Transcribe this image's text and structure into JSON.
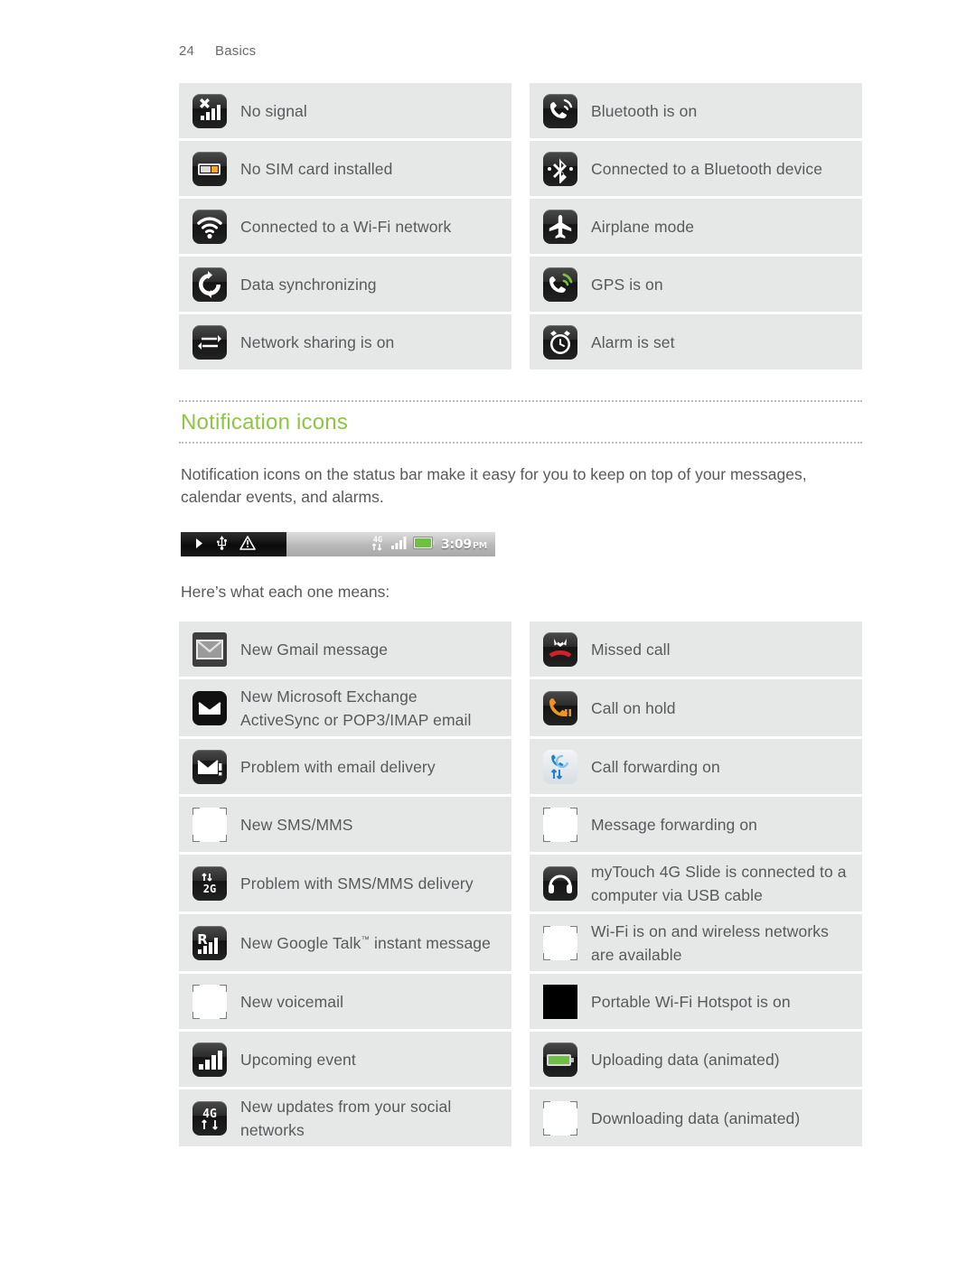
{
  "header": {
    "page_number": "24",
    "section": "Basics"
  },
  "status_icons_table": {
    "rows": [
      {
        "left": {
          "icon": "no-signal-icon",
          "label": "No signal"
        },
        "right": {
          "icon": "bluetooth-on-icon",
          "label": "Bluetooth is on"
        }
      },
      {
        "left": {
          "icon": "no-sim-card-icon",
          "label": "No SIM card installed"
        },
        "right": {
          "icon": "bluetooth-connected-icon",
          "label": "Connected to a Bluetooth device"
        }
      },
      {
        "left": {
          "icon": "wifi-connected-icon",
          "label": "Connected to a Wi-Fi network"
        },
        "right": {
          "icon": "airplane-mode-icon",
          "label": "Airplane mode"
        }
      },
      {
        "left": {
          "icon": "data-sync-icon",
          "label": "Data synchronizing"
        },
        "right": {
          "icon": "gps-on-icon",
          "label": "GPS is on"
        }
      },
      {
        "left": {
          "icon": "network-sharing-icon",
          "label": "Network sharing is on"
        },
        "right": {
          "icon": "alarm-set-icon",
          "label": "Alarm is set"
        }
      }
    ]
  },
  "notification_section": {
    "title": "Notification icons",
    "intro": "Notification icons on the status bar make it easy for you to keep on top of your messages, calendar events, and alarms.",
    "caption": "Here’s what each one means:",
    "statusbar_figure": {
      "left_icons": [
        "play-icon",
        "usb-icon",
        "hazard-triangle-icon"
      ],
      "right_icons": [
        "4g-data-icon",
        "signal-bars-icon",
        "battery-icon"
      ],
      "time": "3:09",
      "meridiem": "PM"
    }
  },
  "notification_icons_table": {
    "rows": [
      {
        "left": {
          "icon": "gmail-icon",
          "label": "New Gmail message"
        },
        "right": {
          "icon": "missed-call-icon",
          "label": "Missed call"
        }
      },
      {
        "left": {
          "icon": "email-icon",
          "label": "New Microsoft Exchange ActiveSync or POP3/IMAP email"
        },
        "right": {
          "icon": "call-on-hold-icon",
          "label": "Call on hold"
        }
      },
      {
        "left": {
          "icon": "email-problem-icon",
          "label": "Problem with email delivery"
        },
        "right": {
          "icon": "call-forwarding-icon",
          "label": "Call forwarding on"
        }
      },
      {
        "left": {
          "icon": "blank-placeholder-icon",
          "label": "New SMS/MMS"
        },
        "right": {
          "icon": "blank-placeholder-icon",
          "label": "Message forwarding on"
        }
      },
      {
        "left": {
          "icon": "sms-problem-icon",
          "label": "Problem with SMS/MMS delivery"
        },
        "right": {
          "icon": "usb-headset-icon",
          "label": "myTouch 4G Slide is connected to a computer via USB cable"
        }
      },
      {
        "left": {
          "icon": "google-talk-icon",
          "label_pre": "New Google Talk",
          "label_tm": "™",
          "label_post": " instant message"
        },
        "right": {
          "icon": "blank-placeholder-icon",
          "label": "Wi-Fi is on and wireless networks are available"
        }
      },
      {
        "left": {
          "icon": "blank-placeholder-icon",
          "label": "New voicemail"
        },
        "right": {
          "icon": "black-square-icon",
          "label": "Portable Wi-Fi Hotspot is on"
        }
      },
      {
        "left": {
          "icon": "upcoming-event-icon",
          "label": "Upcoming event"
        },
        "right": {
          "icon": "uploading-data-icon",
          "label": "Uploading data (animated)"
        }
      },
      {
        "left": {
          "icon": "social-updates-icon",
          "label": "New updates from your social networks"
        },
        "right": {
          "icon": "blank-placeholder-icon",
          "label": "Downloading data (animated)"
        }
      }
    ]
  },
  "colors": {
    "heading_green": "#8dc63f",
    "row_background": "#e6e8e8",
    "body_text": "#58595b",
    "rule": "#b9bcbc"
  }
}
